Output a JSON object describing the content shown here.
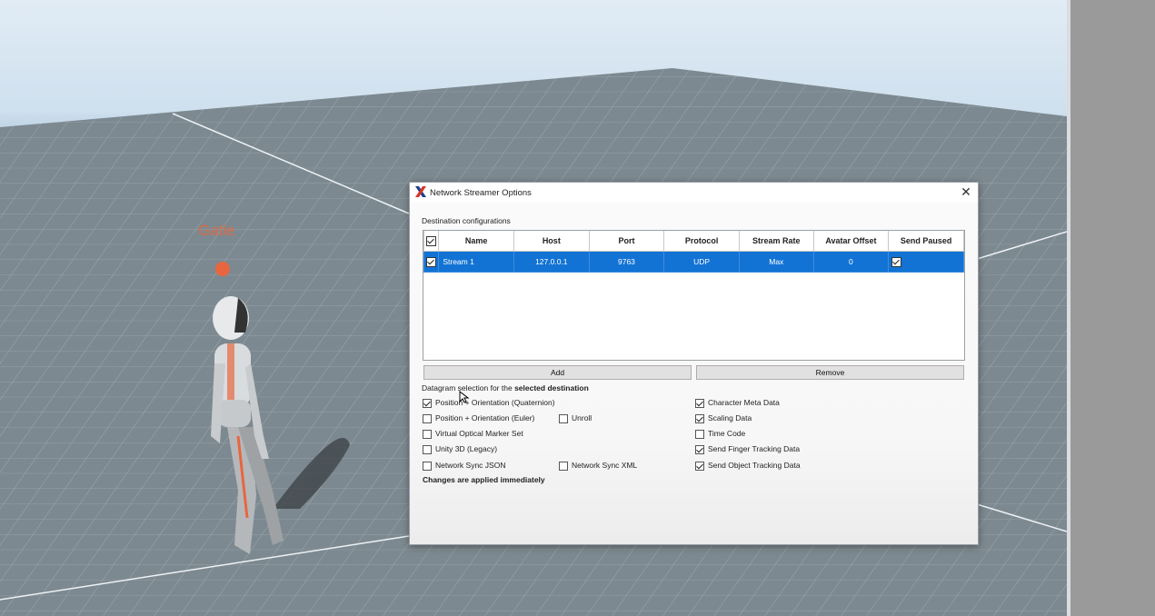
{
  "viewport": {
    "character_name": "Gatie"
  },
  "dialog": {
    "title": "Network Streamer Options",
    "close_symbol": "✕",
    "icon": "x-logo-icon",
    "destination_label": "Destination configurations",
    "table": {
      "columns": [
        "",
        "Name",
        "Host",
        "Port",
        "Protocol",
        "Stream Rate",
        "Avatar Offset",
        "Send Paused"
      ],
      "header_checked": true,
      "rows": [
        {
          "selected": true,
          "enabled": true,
          "name": "Stream 1",
          "host": "127.0.0.1",
          "port": "9763",
          "protocol": "UDP",
          "stream_rate": "Max",
          "avatar_offset": "0",
          "send_paused": true
        }
      ]
    },
    "add_label": "Add",
    "remove_label": "Remove",
    "datagram_label_prefix": "Datagram selection for the ",
    "datagram_label_bold": "selected destination",
    "options": {
      "pos_quat": {
        "label": "Position + Orientation (Quaternion)",
        "checked": true
      },
      "pos_euler": {
        "label": "Position + Orientation (Euler)",
        "checked": false
      },
      "unroll": {
        "label": "Unroll",
        "checked": false
      },
      "virtual_marker": {
        "label": "Virtual Optical Marker Set",
        "checked": false
      },
      "unity": {
        "label": "Unity 3D (Legacy)",
        "checked": false
      },
      "sync_json": {
        "label": "Network Sync JSON",
        "checked": false
      },
      "sync_xml": {
        "label": "Network Sync XML",
        "checked": false
      },
      "char_meta": {
        "label": "Character Meta Data",
        "checked": true
      },
      "scaling": {
        "label": "Scaling Data",
        "checked": true
      },
      "timecode": {
        "label": "Time Code",
        "checked": false
      },
      "finger": {
        "label": "Send Finger Tracking Data",
        "checked": true
      },
      "object": {
        "label": "Send Object Tracking Data",
        "checked": true
      }
    },
    "changes_note": "Changes are applied immediately"
  },
  "colors": {
    "selection": "#1273d4",
    "accent_orange": "#e8663f",
    "logo_blue": "#1b3f8f",
    "logo_red": "#d8342a"
  }
}
